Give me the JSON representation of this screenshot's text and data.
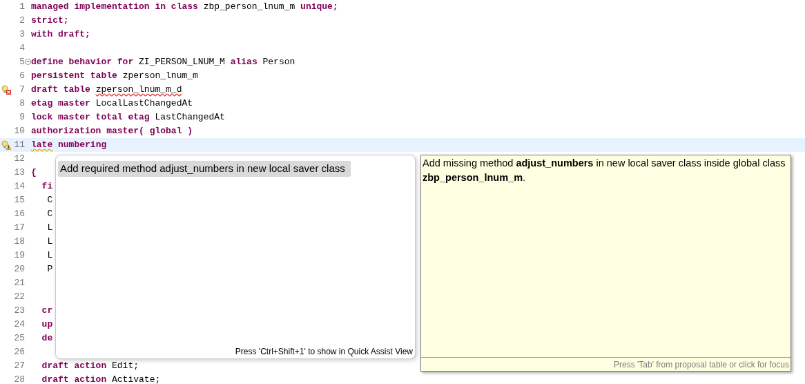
{
  "editor": {
    "lines": [
      {
        "number": "1",
        "current": false,
        "tokens": [
          {
            "text": "managed implementation in class",
            "kind": "keyword"
          },
          {
            "text": " zbp_person_lnum_m ",
            "kind": "text"
          },
          {
            "text": "unique;",
            "kind": "keyword"
          }
        ]
      },
      {
        "number": "2",
        "current": false,
        "tokens": [
          {
            "text": "strict;",
            "kind": "keyword"
          }
        ]
      },
      {
        "number": "3",
        "current": false,
        "tokens": [
          {
            "text": "with draft;",
            "kind": "keyword"
          }
        ]
      },
      {
        "number": "4",
        "current": false
      },
      {
        "number": "5",
        "current": false,
        "marker": {
          "kind": "fold"
        },
        "tokens": [
          {
            "text": "define behavior for",
            "kind": "keyword"
          },
          {
            "text": " ZI_PERSON_LNUM_M ",
            "kind": "text"
          },
          {
            "text": "alias",
            "kind": "keyword"
          },
          {
            "text": " Person",
            "kind": "text"
          }
        ]
      },
      {
        "number": "6",
        "current": false,
        "tokens": [
          {
            "text": "persistent table",
            "kind": "keyword"
          },
          {
            "text": " zperson_lnum_m",
            "kind": "text"
          }
        ]
      },
      {
        "number": "7",
        "current": false,
        "marker": {
          "kind": "quickfix_error"
        },
        "tokens": [
          {
            "text": "draft table ",
            "kind": "keyword"
          },
          {
            "text": "zperson_lnum_m_d",
            "kind": "text",
            "squiggle": {
              "kind": "error"
            }
          }
        ]
      },
      {
        "number": "8",
        "current": false,
        "tokens": [
          {
            "text": "etag master",
            "kind": "keyword"
          },
          {
            "text": " LocalLastChangedAt",
            "kind": "text"
          }
        ]
      },
      {
        "number": "9",
        "current": false,
        "tokens": [
          {
            "text": "lock master total etag",
            "kind": "keyword"
          },
          {
            "text": " LastChangedAt",
            "kind": "text"
          }
        ]
      },
      {
        "number": "10",
        "current": false,
        "tokens": [
          {
            "text": "authorization master( global )",
            "kind": "keyword"
          }
        ]
      },
      {
        "number": "11",
        "current": true,
        "marker": {
          "kind": "quickfix_warning"
        },
        "tokens": [
          {
            "text": "late",
            "kind": "keyword",
            "squiggle": {
              "kind": "warning"
            }
          },
          {
            "text": " numbering",
            "kind": "keyword"
          }
        ]
      },
      {
        "number": "12",
        "current": false
      },
      {
        "number": "13",
        "current": false,
        "tokens": [
          {
            "text": "{",
            "kind": "keyword"
          }
        ]
      },
      {
        "number": "14",
        "current": false,
        "tokens": [
          {
            "text": "  fi",
            "kind": "keyword"
          }
        ]
      },
      {
        "number": "15",
        "current": false,
        "tokens": [
          {
            "text": "   C",
            "kind": "text"
          }
        ]
      },
      {
        "number": "16",
        "current": false,
        "tokens": [
          {
            "text": "   C",
            "kind": "text"
          }
        ]
      },
      {
        "number": "17",
        "current": false,
        "tokens": [
          {
            "text": "   L",
            "kind": "text"
          }
        ]
      },
      {
        "number": "18",
        "current": false,
        "tokens": [
          {
            "text": "   L",
            "kind": "text"
          }
        ]
      },
      {
        "number": "19",
        "current": false,
        "tokens": [
          {
            "text": "   L",
            "kind": "text"
          }
        ]
      },
      {
        "number": "20",
        "current": false,
        "tokens": [
          {
            "text": "   P",
            "kind": "text"
          }
        ]
      },
      {
        "number": "21",
        "current": false
      },
      {
        "number": "22",
        "current": false
      },
      {
        "number": "23",
        "current": false,
        "tokens": [
          {
            "text": "  cr",
            "kind": "keyword"
          }
        ]
      },
      {
        "number": "24",
        "current": false,
        "tokens": [
          {
            "text": "  up",
            "kind": "keyword"
          }
        ]
      },
      {
        "number": "25",
        "current": false,
        "tokens": [
          {
            "text": "  de",
            "kind": "keyword"
          }
        ]
      },
      {
        "number": "26",
        "current": false
      },
      {
        "number": "27",
        "current": false,
        "tokens": [
          {
            "text": "  draft action",
            "kind": "keyword"
          },
          {
            "text": " Edit;",
            "kind": "text"
          }
        ]
      },
      {
        "number": "28",
        "current": false,
        "tokens": [
          {
            "text": "  draft action",
            "kind": "keyword"
          },
          {
            "text": " Activate;",
            "kind": "text"
          }
        ]
      }
    ]
  },
  "quick_fix": {
    "proposals": [
      {
        "label": "Add required method adjust_numbers in new local saver class",
        "selected": true
      }
    ],
    "hint": "Press 'Ctrl+Shift+1' to show in Quick Assist View"
  },
  "details": {
    "description": "Add missing method **adjust_numbers** in new local saver class inside global class **zbp_person_lnum_m**.",
    "hint": "Press 'Tab' from proposal table or click for focus"
  }
}
